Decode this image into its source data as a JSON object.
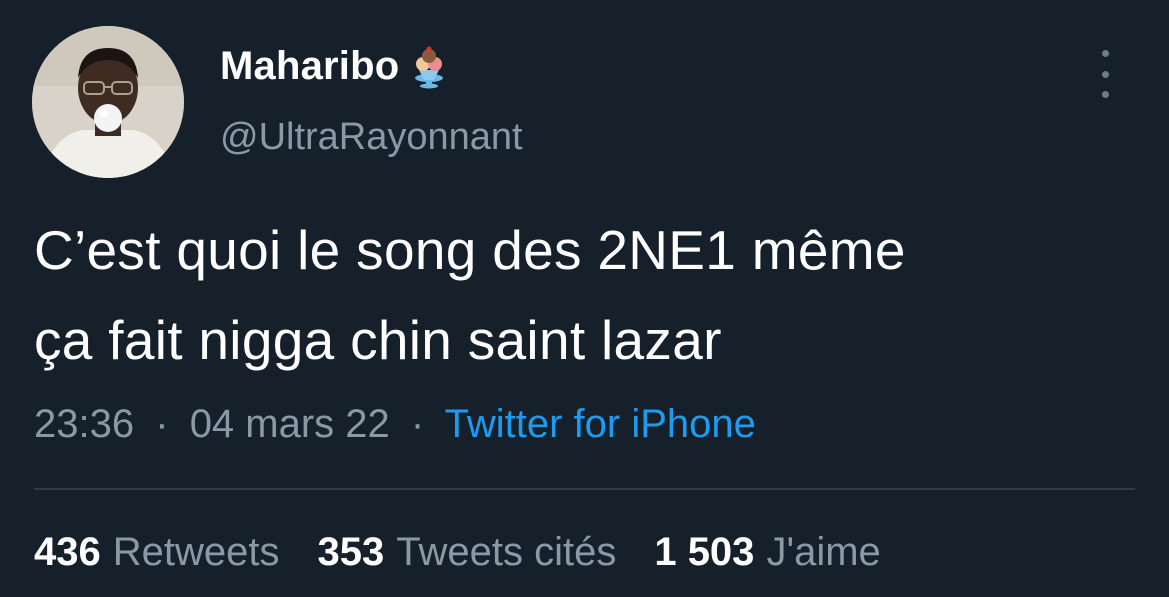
{
  "user": {
    "display_name": "Maharibo",
    "emoji_icon": "ice-cream-icon",
    "handle": "@UltraRayonnant"
  },
  "tweet": {
    "line1": "C’est quoi le song des 2NE1 même",
    "line2": "ça fait nigga chin saint lazar"
  },
  "meta": {
    "time": "23:36",
    "separator": "·",
    "date": "04 mars 22",
    "source": "Twitter for iPhone"
  },
  "stats": {
    "retweets_count": "436",
    "retweets_label": "Retweets",
    "quotes_count": "353",
    "quotes_label": "Tweets cités",
    "likes_count": "1 503",
    "likes_label": "J'aime"
  },
  "colors": {
    "background": "#15202b",
    "text_primary": "#ffffff",
    "text_secondary": "#8b98a5",
    "link": "#1d9bf0",
    "divider": "#2f3b47"
  }
}
